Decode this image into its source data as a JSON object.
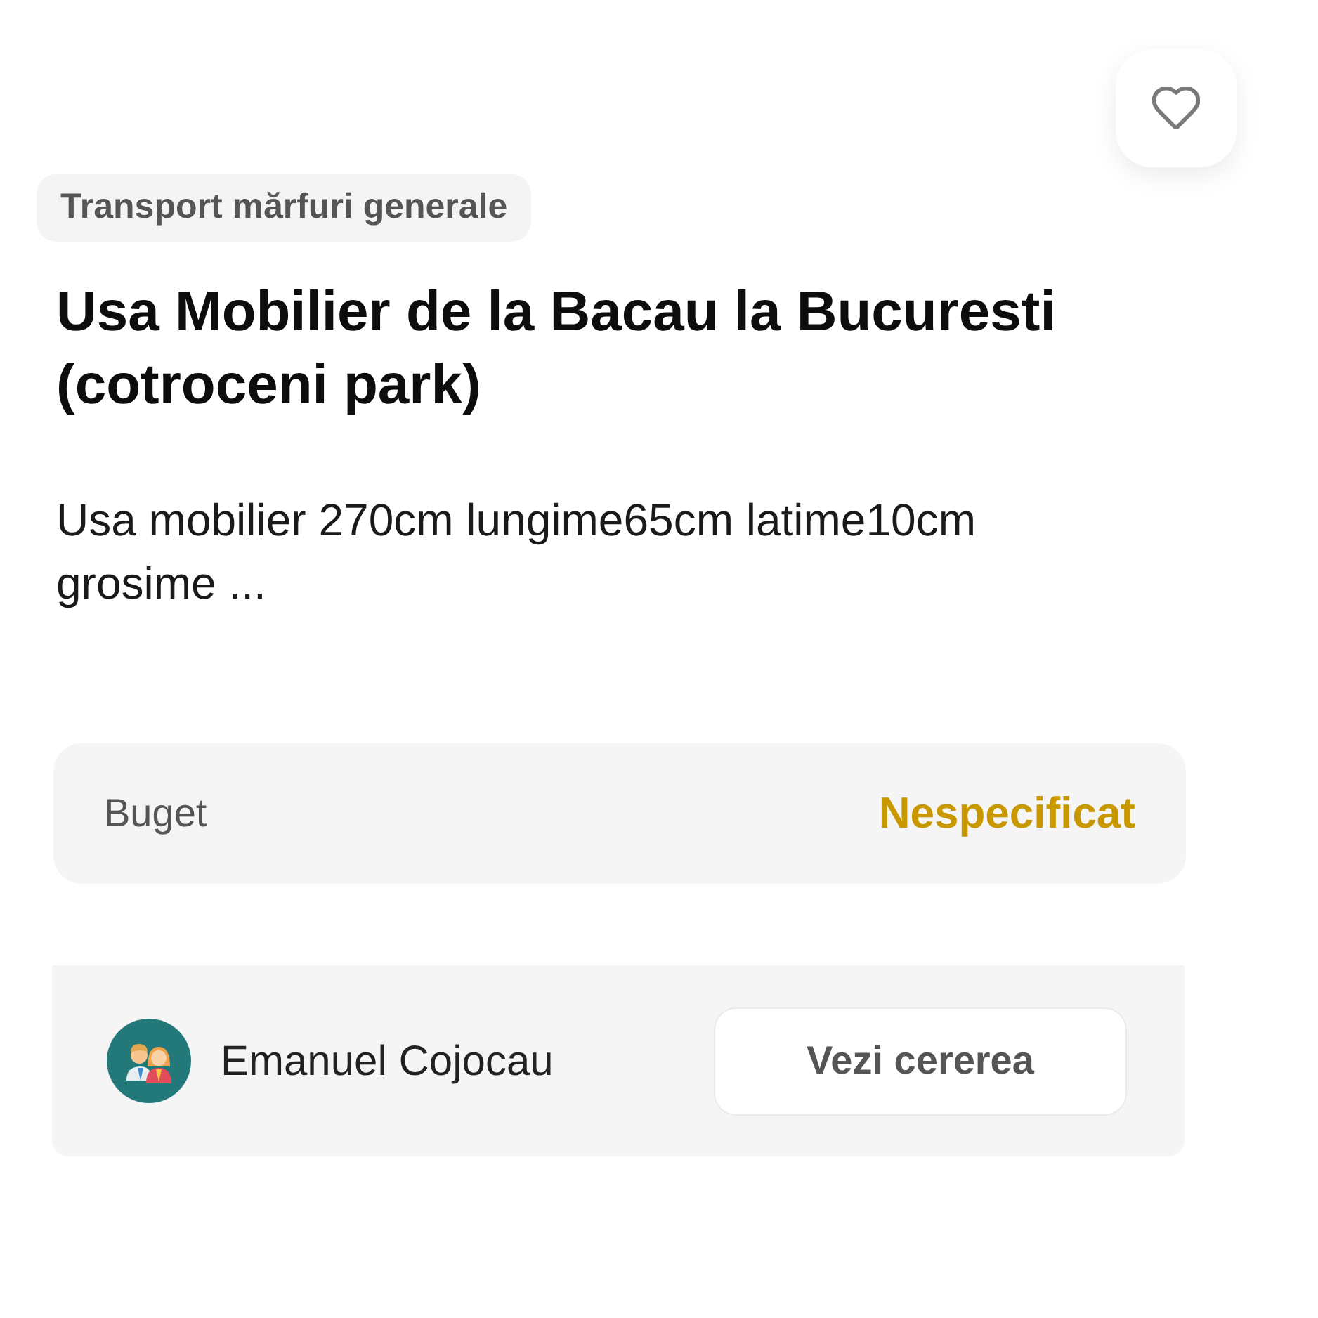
{
  "favorite_button": {
    "favorited": false
  },
  "category_tag": "Transport mărfuri generale",
  "title": "Usa Mobilier de la Bacau la Bucuresti (cotroceni park)",
  "description": "Usa mobilier 270cm lungime65cm latime10cm grosime ...",
  "budget": {
    "label": "Buget",
    "value": "Nespecificat"
  },
  "requester": {
    "name": "Emanuel Cojocau"
  },
  "action_button": {
    "label": "Vezi cererea"
  }
}
